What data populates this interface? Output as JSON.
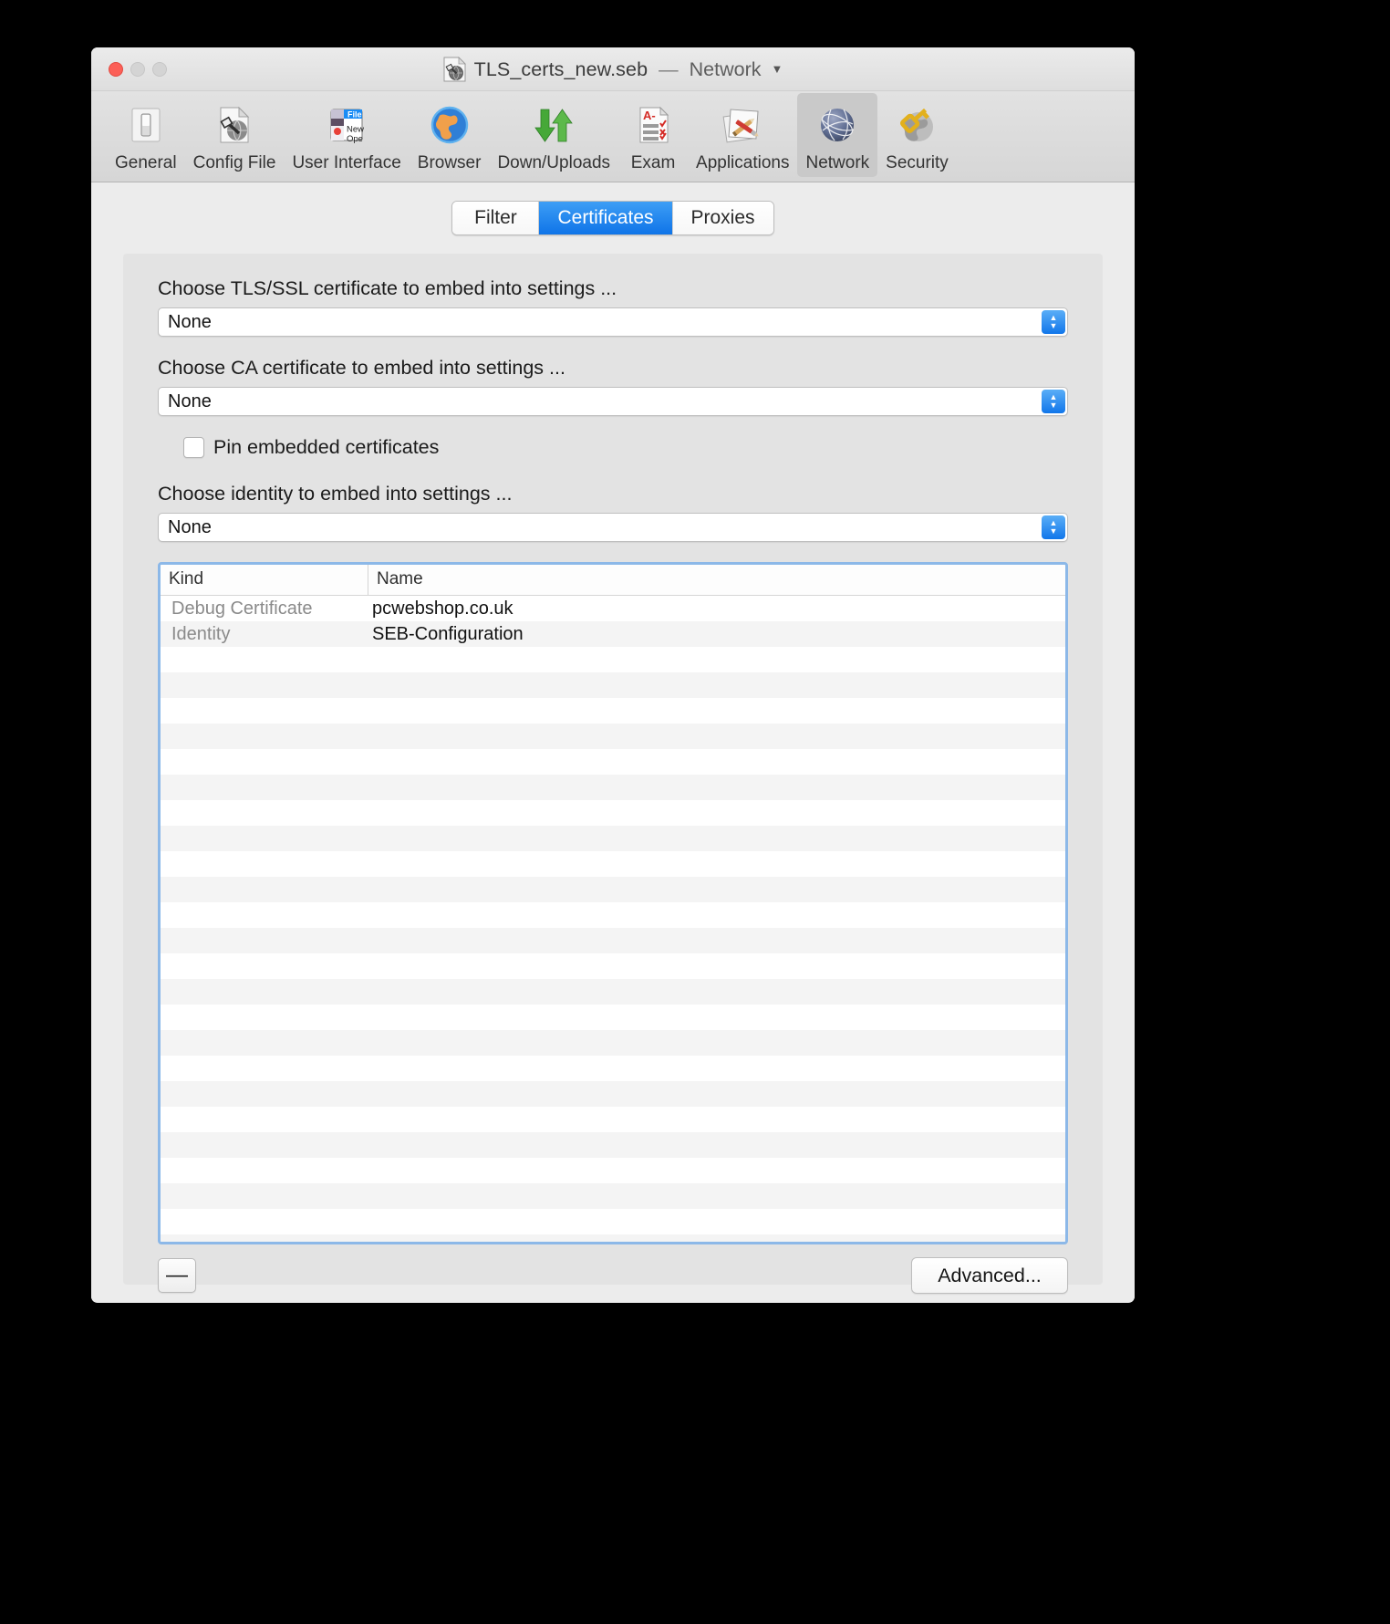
{
  "window": {
    "title_file": "TLS_certs_new.seb",
    "title_separator": "—",
    "title_scope": "Network",
    "title_caret": "▼",
    "doc_icon": "seb-config-document-icon",
    "traffic_lights": [
      "close-button",
      "minimize-button",
      "zoom-button"
    ]
  },
  "toolbar": {
    "items": [
      {
        "label": "General",
        "icon": "switch-icon",
        "selected": false
      },
      {
        "label": "Config File",
        "icon": "config-file-icon",
        "selected": false
      },
      {
        "label": "User Interface",
        "icon": "user-interface-icon",
        "selected": false
      },
      {
        "label": "Browser",
        "icon": "globe-browser-icon",
        "selected": false
      },
      {
        "label": "Down/Uploads",
        "icon": "down-up-arrows-icon",
        "selected": false
      },
      {
        "label": "Exam",
        "icon": "exam-paper-icon",
        "selected": false
      },
      {
        "label": "Applications",
        "icon": "applications-icon",
        "selected": false
      },
      {
        "label": "Network",
        "icon": "network-globe-icon",
        "selected": true
      },
      {
        "label": "Security",
        "icon": "security-key-globe-icon",
        "selected": false
      }
    ]
  },
  "tabs": {
    "items": [
      {
        "label": "Filter",
        "active": false
      },
      {
        "label": "Certificates",
        "active": true
      },
      {
        "label": "Proxies",
        "active": false
      }
    ],
    "active_color": "#1176ea"
  },
  "form": {
    "tls_label": "Choose TLS/SSL certificate to embed into settings ...",
    "tls_value": "None",
    "ca_label": "Choose CA certificate to embed into settings ...",
    "ca_value": "None",
    "pin_checkbox_label": "Pin embedded certificates",
    "pin_checked": false,
    "identity_label": "Choose identity to embed into settings ...",
    "identity_value": "None"
  },
  "table": {
    "columns": [
      "Kind",
      "Name"
    ],
    "rows": [
      {
        "kind": "Debug Certificate",
        "name": "pcwebshop.co.uk"
      },
      {
        "kind": "Identity",
        "name": "SEB-Configuration"
      }
    ],
    "empty_row_count": 24,
    "focus_ring_color": "#8cb8e8"
  },
  "bottom": {
    "remove_label": "—",
    "advanced_label": "Advanced..."
  }
}
